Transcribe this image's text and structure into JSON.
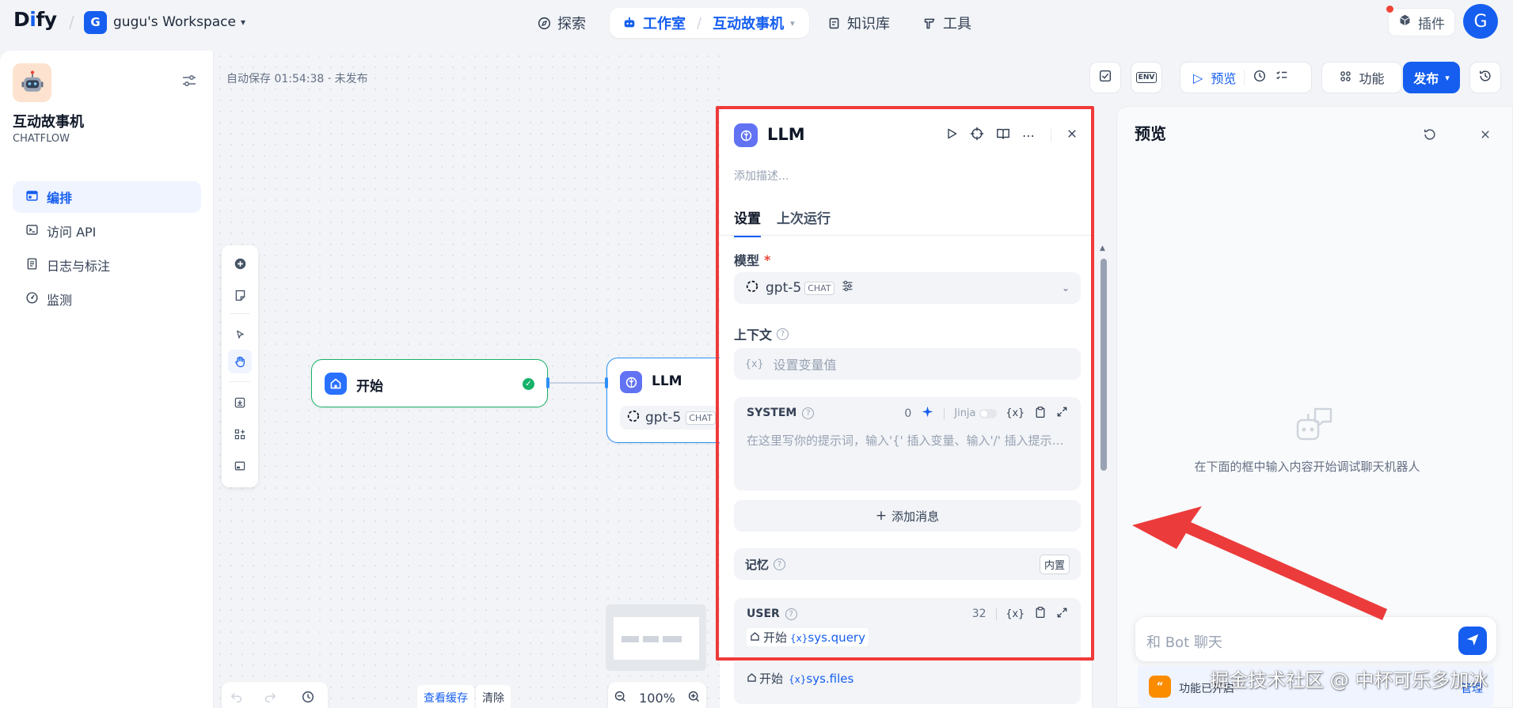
{
  "topbar": {
    "logo_prefix": "D",
    "logo_i": "i",
    "logo_suffix": "fy",
    "workspace_initial": "G",
    "workspace_name": "gugu's Workspace",
    "nav": {
      "explore": "探索",
      "studio": "工作室",
      "app_name": "互动故事机",
      "knowledge": "知识库",
      "tools": "工具"
    },
    "plugins": "插件",
    "user_initial": "G"
  },
  "sidebar": {
    "app_name": "互动故事机",
    "app_type": "CHATFLOW",
    "items": [
      {
        "label": "编排",
        "icon": "layout-icon",
        "active": true
      },
      {
        "label": "访问 API",
        "icon": "terminal-icon",
        "active": false
      },
      {
        "label": "日志与标注",
        "icon": "file-list-icon",
        "active": false
      },
      {
        "label": "监测",
        "icon": "dashboard-icon",
        "active": false
      }
    ]
  },
  "canvas": {
    "autosave": "自动保存 01:54:38 · 未发布",
    "start_node_title": "开始",
    "llm_node_title": "LLM",
    "llm_node_model": "gpt-5",
    "llm_node_tag": "CHAT",
    "view_cache": "查看缓存",
    "clear": "清除",
    "zoom": "100%"
  },
  "actions": {
    "env": "ENV",
    "preview": "预览",
    "features": "功能",
    "publish": "发布"
  },
  "llm_panel": {
    "title": "LLM",
    "description_placeholder": "添加描述...",
    "tabs": [
      "设置",
      "上次运行"
    ],
    "model_label": "模型",
    "required_mark": "*",
    "model_name": "gpt-5",
    "model_tag": "CHAT",
    "context_label": "上下文",
    "context_var_icon": "{x}",
    "context_placeholder": "设置变量值",
    "system_label": "SYSTEM",
    "system_count": "0",
    "jinja": "Jinja",
    "var_icon": "{x}",
    "system_placeholder": "在这里写你的提示词，输入'{' 插入变量、输入'/' 插入提示内容块",
    "add_message": "添加消息",
    "memory_label": "记忆",
    "memory_builtin": "内置",
    "user_label": "USER",
    "user_count": "32",
    "user_var_node": "开始",
    "user_var_name": "sys.query",
    "files_var_node": "开始",
    "files_var_name": "sys.files"
  },
  "preview": {
    "title": "预览",
    "empty_text": "在下面的框中输入内容开始调试聊天机器人",
    "chat_placeholder": "和 Bot 聊天",
    "feature_text": "功能已开启",
    "feature_manage": "管理"
  },
  "watermark": "掘金技术社区 @ 中杯可乐多加冰",
  "colors": {
    "accent": "#155eef",
    "annotation_red": "#f03a3a",
    "start_node_border": "#17b26a",
    "llm_node_border": "#2e90fa"
  }
}
